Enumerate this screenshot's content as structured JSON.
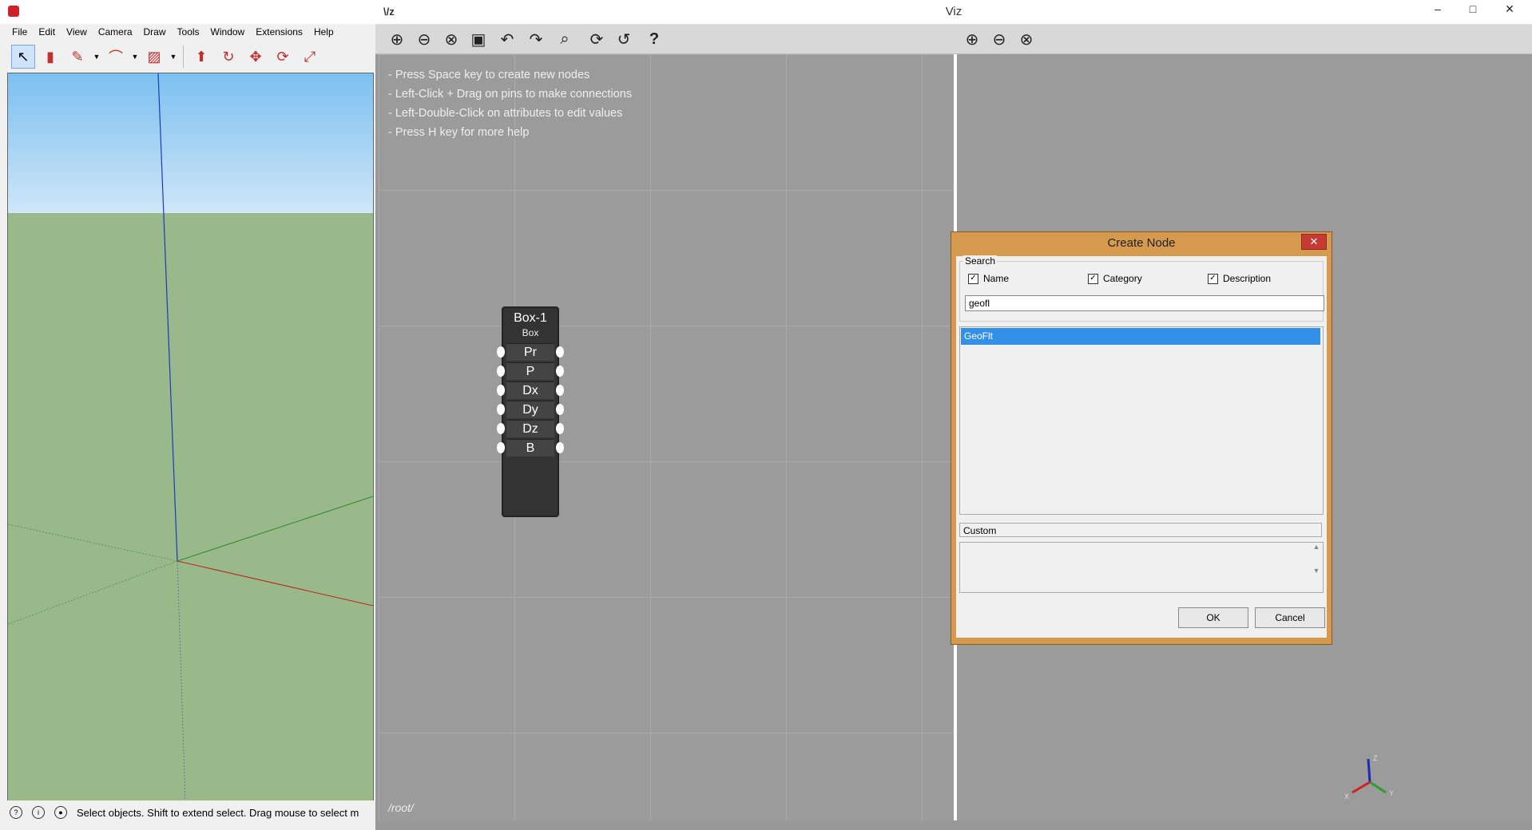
{
  "sketchup": {
    "menu": [
      "File",
      "Edit",
      "View",
      "Camera",
      "Draw",
      "Tools",
      "Window",
      "Extensions",
      "Help"
    ],
    "tools": [
      "select-icon",
      "eraser-icon",
      "pencil-icon",
      "arc-icon",
      "rectangle-icon",
      "pushpull-icon",
      "follow-me-icon",
      "move-icon",
      "rotate-icon",
      "scale-icon"
    ],
    "status_text": "Select objects. Shift to extend select. Drag mouse to select m"
  },
  "viz": {
    "title": "Viz",
    "logo": "\\/z",
    "window_controls": [
      "–",
      "□",
      "✕"
    ],
    "graph_toolbar_icons": [
      "zoom-in-icon",
      "zoom-out-icon",
      "zoom-fit-icon",
      "save-icon",
      "undo-icon",
      "redo-icon",
      "search-icon",
      "refresh-icon",
      "refresh-all-icon",
      "help-icon"
    ],
    "view_toolbar_icons": [
      "zoom-in-icon",
      "zoom-out-icon",
      "zoom-fit-icon"
    ],
    "help_lines": [
      "- Press Space key to create new nodes",
      "- Left-Click + Drag on pins to make connections",
      "- Left-Double-Click on attributes to edit values",
      "- Press H key for more help"
    ],
    "root_path": "/root/",
    "node": {
      "title": "Box-1",
      "type": "Box",
      "pins": [
        "Pr",
        "P",
        "Dx",
        "Dy",
        "Dz",
        "B"
      ]
    },
    "axes": {
      "x": "X",
      "y": "Y",
      "z": "Z"
    }
  },
  "dialog": {
    "title": "Create Node",
    "close": "✕",
    "search_group": "Search",
    "checks": [
      {
        "label": "Name",
        "checked": true
      },
      {
        "label": "Category",
        "checked": true
      },
      {
        "label": "Description",
        "checked": true
      }
    ],
    "search_value": "geofl",
    "results": [
      "GeoFlt"
    ],
    "custom_label": "Custom",
    "description": "",
    "ok": "OK",
    "cancel": "Cancel"
  },
  "colors": {
    "dialog_frame": "#d69a4f",
    "selection": "#3390e8",
    "grid_bg": "#9b9b9b"
  }
}
